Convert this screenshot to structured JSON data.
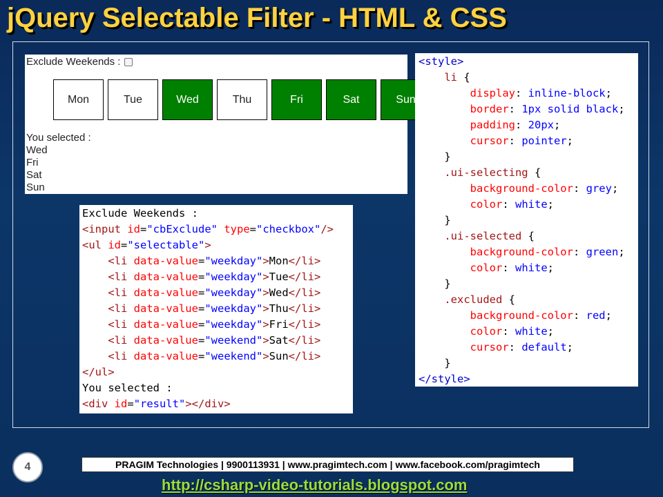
{
  "slide": {
    "title": "jQuery Selectable Filter - HTML & CSS"
  },
  "demo": {
    "exclude_label": "Exclude Weekends :",
    "days": [
      {
        "label": "Mon",
        "selected": false
      },
      {
        "label": "Tue",
        "selected": false
      },
      {
        "label": "Wed",
        "selected": true
      },
      {
        "label": "Thu",
        "selected": false
      },
      {
        "label": "Fri",
        "selected": true
      },
      {
        "label": "Sat",
        "selected": true
      },
      {
        "label": "Sun",
        "selected": true
      }
    ],
    "result_label": "You selected :",
    "result_items": [
      "Wed",
      "Fri",
      "Sat",
      "Sun"
    ],
    "selected_color": "#008000"
  },
  "html_code": {
    "lines": [
      [
        [
          "t",
          "Exclude Weekends :"
        ]
      ],
      [
        [
          "g",
          "<input "
        ],
        [
          "a",
          "id"
        ],
        [
          "t",
          "="
        ],
        [
          "v",
          "\"cbExclude\""
        ],
        [
          "t",
          " "
        ],
        [
          "a",
          "type"
        ],
        [
          "t",
          "="
        ],
        [
          "v",
          "\"checkbox\""
        ],
        [
          "g",
          "/>"
        ]
      ],
      [
        [
          "g",
          "<ul "
        ],
        [
          "a",
          "id"
        ],
        [
          "t",
          "="
        ],
        [
          "v",
          "\"selectable\""
        ],
        [
          "g",
          ">"
        ]
      ],
      [
        [
          "t",
          "    "
        ],
        [
          "g",
          "<li "
        ],
        [
          "a",
          "data-value"
        ],
        [
          "t",
          "="
        ],
        [
          "v",
          "\"weekday\""
        ],
        [
          "g",
          ">"
        ],
        [
          "t",
          "Mon"
        ],
        [
          "g",
          "</li>"
        ]
      ],
      [
        [
          "t",
          "    "
        ],
        [
          "g",
          "<li "
        ],
        [
          "a",
          "data-value"
        ],
        [
          "t",
          "="
        ],
        [
          "v",
          "\"weekday\""
        ],
        [
          "g",
          ">"
        ],
        [
          "t",
          "Tue"
        ],
        [
          "g",
          "</li>"
        ]
      ],
      [
        [
          "t",
          "    "
        ],
        [
          "g",
          "<li "
        ],
        [
          "a",
          "data-value"
        ],
        [
          "t",
          "="
        ],
        [
          "v",
          "\"weekday\""
        ],
        [
          "g",
          ">"
        ],
        [
          "t",
          "Wed"
        ],
        [
          "g",
          "</li>"
        ]
      ],
      [
        [
          "t",
          "    "
        ],
        [
          "g",
          "<li "
        ],
        [
          "a",
          "data-value"
        ],
        [
          "t",
          "="
        ],
        [
          "v",
          "\"weekday\""
        ],
        [
          "g",
          ">"
        ],
        [
          "t",
          "Thu"
        ],
        [
          "g",
          "</li>"
        ]
      ],
      [
        [
          "t",
          "    "
        ],
        [
          "g",
          "<li "
        ],
        [
          "a",
          "data-value"
        ],
        [
          "t",
          "="
        ],
        [
          "v",
          "\"weekday\""
        ],
        [
          "g",
          ">"
        ],
        [
          "t",
          "Fri"
        ],
        [
          "g",
          "</li>"
        ]
      ],
      [
        [
          "t",
          "    "
        ],
        [
          "g",
          "<li "
        ],
        [
          "a",
          "data-value"
        ],
        [
          "t",
          "="
        ],
        [
          "v",
          "\"weekend\""
        ],
        [
          "g",
          ">"
        ],
        [
          "t",
          "Sat"
        ],
        [
          "g",
          "</li>"
        ]
      ],
      [
        [
          "t",
          "    "
        ],
        [
          "g",
          "<li "
        ],
        [
          "a",
          "data-value"
        ],
        [
          "t",
          "="
        ],
        [
          "v",
          "\"weekend\""
        ],
        [
          "g",
          ">"
        ],
        [
          "t",
          "Sun"
        ],
        [
          "g",
          "</li>"
        ]
      ],
      [
        [
          "g",
          "</ul>"
        ]
      ],
      [
        [
          "t",
          "You selected :"
        ]
      ],
      [
        [
          "g",
          "<div "
        ],
        [
          "a",
          "id"
        ],
        [
          "t",
          "="
        ],
        [
          "v",
          "\"result\""
        ],
        [
          "g",
          "></div>"
        ]
      ]
    ]
  },
  "css_code": {
    "lines": [
      [
        [
          "b",
          "<style>"
        ]
      ],
      [
        [
          "t",
          "    "
        ],
        [
          "g",
          "li"
        ],
        [
          "t",
          " {"
        ]
      ],
      [
        [
          "t",
          "        "
        ],
        [
          "a",
          "display"
        ],
        [
          "t",
          ": "
        ],
        [
          "v",
          "inline-block"
        ],
        [
          "t",
          ";"
        ]
      ],
      [
        [
          "t",
          "        "
        ],
        [
          "a",
          "border"
        ],
        [
          "t",
          ": "
        ],
        [
          "v",
          "1px solid black"
        ],
        [
          "t",
          ";"
        ]
      ],
      [
        [
          "t",
          "        "
        ],
        [
          "a",
          "padding"
        ],
        [
          "t",
          ": "
        ],
        [
          "v",
          "20px"
        ],
        [
          "t",
          ";"
        ]
      ],
      [
        [
          "t",
          "        "
        ],
        [
          "a",
          "cursor"
        ],
        [
          "t",
          ": "
        ],
        [
          "v",
          "pointer"
        ],
        [
          "t",
          ";"
        ]
      ],
      [
        [
          "t",
          "    }"
        ]
      ],
      [
        [
          "t",
          "    "
        ],
        [
          "g",
          ".ui-selecting"
        ],
        [
          "t",
          " {"
        ]
      ],
      [
        [
          "t",
          "        "
        ],
        [
          "a",
          "background-color"
        ],
        [
          "t",
          ": "
        ],
        [
          "v",
          "grey"
        ],
        [
          "t",
          ";"
        ]
      ],
      [
        [
          "t",
          "        "
        ],
        [
          "a",
          "color"
        ],
        [
          "t",
          ": "
        ],
        [
          "v",
          "white"
        ],
        [
          "t",
          ";"
        ]
      ],
      [
        [
          "t",
          "    }"
        ]
      ],
      [
        [
          "t",
          "    "
        ],
        [
          "g",
          ".ui-selected"
        ],
        [
          "t",
          " {"
        ]
      ],
      [
        [
          "t",
          "        "
        ],
        [
          "a",
          "background-color"
        ],
        [
          "t",
          ": "
        ],
        [
          "v",
          "green"
        ],
        [
          "t",
          ";"
        ]
      ],
      [
        [
          "t",
          "        "
        ],
        [
          "a",
          "color"
        ],
        [
          "t",
          ": "
        ],
        [
          "v",
          "white"
        ],
        [
          "t",
          ";"
        ]
      ],
      [
        [
          "t",
          "    }"
        ]
      ],
      [
        [
          "t",
          "    "
        ],
        [
          "g",
          ".excluded"
        ],
        [
          "t",
          " {"
        ]
      ],
      [
        [
          "t",
          "        "
        ],
        [
          "a",
          "background-color"
        ],
        [
          "t",
          ": "
        ],
        [
          "v",
          "red"
        ],
        [
          "t",
          ";"
        ]
      ],
      [
        [
          "t",
          "        "
        ],
        [
          "a",
          "color"
        ],
        [
          "t",
          ": "
        ],
        [
          "v",
          "white"
        ],
        [
          "t",
          ";"
        ]
      ],
      [
        [
          "t",
          "        "
        ],
        [
          "a",
          "cursor"
        ],
        [
          "t",
          ": "
        ],
        [
          "v",
          "default"
        ],
        [
          "t",
          ";"
        ]
      ],
      [
        [
          "t",
          "    }"
        ]
      ],
      [
        [
          "b",
          "</style>"
        ]
      ]
    ]
  },
  "footer": {
    "page_number": "4",
    "company": "PRAGIM Technologies | 9900113931 | www.pragimtech.com | www.facebook.com/pragimtech",
    "blog_url": "http://csharp-video-tutorials.blogspot.com"
  },
  "colors": {
    "title": "#ffd23f",
    "tag": "#a31515",
    "attribute": "#ff0000",
    "value": "#0000ff",
    "link": "#9cdc3c"
  }
}
